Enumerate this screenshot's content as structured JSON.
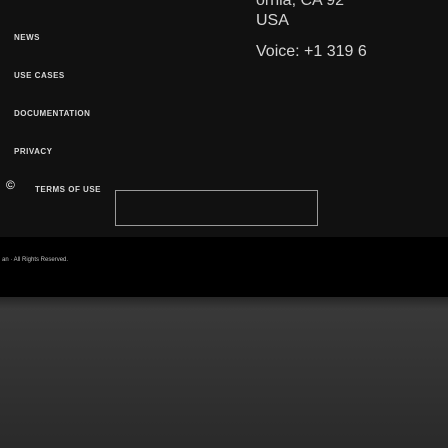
{
  "address": {
    "partial_line": "ornia, CA 92",
    "country": "USA",
    "phone": "Voice: +1 319 6"
  },
  "nav": {
    "items": [
      {
        "label": "News"
      },
      {
        "label": "Use Cases"
      },
      {
        "label": "Documentation"
      },
      {
        "label": "Privacy"
      },
      {
        "label": "Terms of Use"
      }
    ]
  },
  "copyright_fragment": "©",
  "footer": {
    "rights": "an · All Rights Reserved."
  }
}
